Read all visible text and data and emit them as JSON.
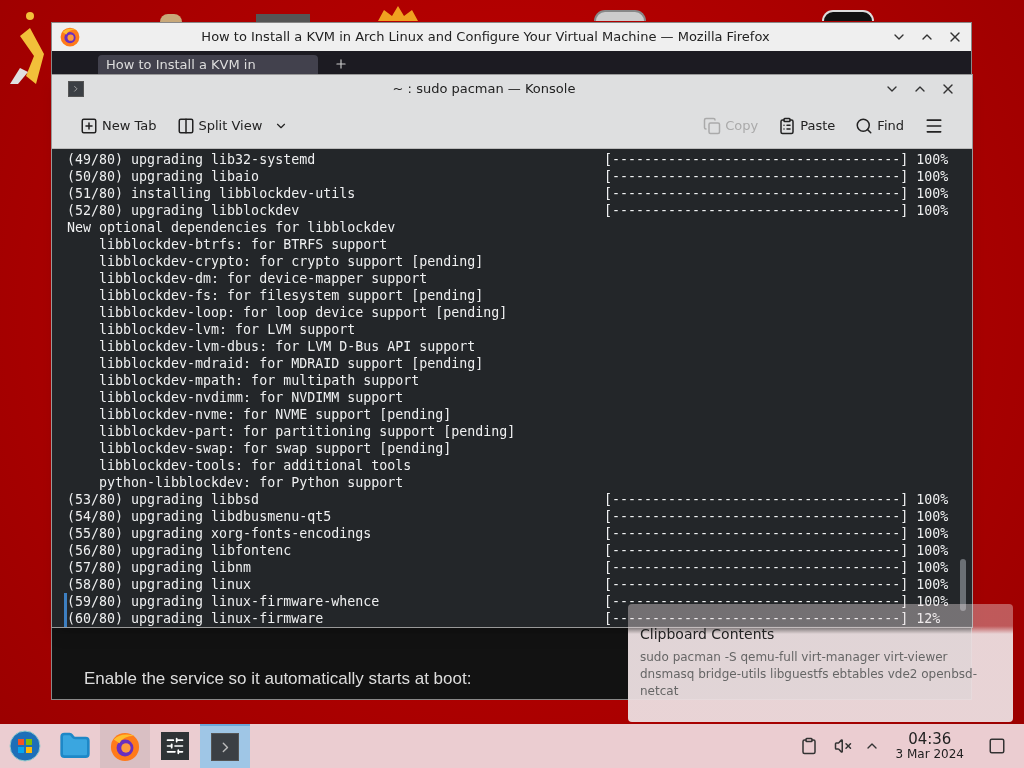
{
  "firefox": {
    "title": "How to Install a KVM in Arch Linux and Configure Your Virtual Machine — Mozilla Firefox",
    "tab": {
      "title": "How to Install a KVM in"
    },
    "content": {
      "text": "Enable the service so it automatically starts at boot:"
    }
  },
  "konsole": {
    "title": "~ : sudo pacman — Konsole",
    "toolbar": [
      {
        "kind": "new-tab",
        "label": "New Tab",
        "disabled": false
      },
      {
        "kind": "split",
        "label": "Split View",
        "disabled": false
      },
      {
        "kind": "copy",
        "label": "Copy",
        "disabled": true
      },
      {
        "kind": "paste",
        "label": "Paste",
        "disabled": false
      },
      {
        "kind": "find",
        "label": "Find",
        "disabled": false
      }
    ],
    "lines": [
      {
        "text": "(49/80) upgrading lib32-systemd",
        "bar": "[------------------------------------]",
        "percent": "100%",
        "marked": false
      },
      {
        "text": "(50/80) upgrading libaio",
        "bar": "[------------------------------------]",
        "percent": "100%",
        "marked": false
      },
      {
        "text": "(51/80) installing libblockdev-utils",
        "bar": "[------------------------------------]",
        "percent": "100%",
        "marked": false
      },
      {
        "text": "(52/80) upgrading libblockdev",
        "bar": "[------------------------------------]",
        "percent": "100%",
        "marked": false
      },
      {
        "text": "New optional dependencies for libblockdev",
        "marked": false
      },
      {
        "text": "    libblockdev-btrfs: for BTRFS support",
        "marked": false
      },
      {
        "text": "    libblockdev-crypto: for crypto support [pending]",
        "marked": false
      },
      {
        "text": "    libblockdev-dm: for device-mapper support",
        "marked": false
      },
      {
        "text": "    libblockdev-fs: for filesystem support [pending]",
        "marked": false
      },
      {
        "text": "    libblockdev-loop: for loop device support [pending]",
        "marked": false
      },
      {
        "text": "    libblockdev-lvm: for LVM support",
        "marked": false
      },
      {
        "text": "    libblockdev-lvm-dbus: for LVM D-Bus API support",
        "marked": false
      },
      {
        "text": "    libblockdev-mdraid: for MDRAID support [pending]",
        "marked": false
      },
      {
        "text": "    libblockdev-mpath: for multipath support",
        "marked": false
      },
      {
        "text": "    libblockdev-nvdimm: for NVDIMM support",
        "marked": false
      },
      {
        "text": "    libblockdev-nvme: for NVME support [pending]",
        "marked": false
      },
      {
        "text": "    libblockdev-part: for partitioning support [pending]",
        "marked": false
      },
      {
        "text": "    libblockdev-swap: for swap support [pending]",
        "marked": false
      },
      {
        "text": "    libblockdev-tools: for additional tools",
        "marked": false
      },
      {
        "text": "    python-libblockdev: for Python support",
        "marked": false
      },
      {
        "text": "(53/80) upgrading libbsd",
        "bar": "[------------------------------------]",
        "percent": "100%",
        "marked": false
      },
      {
        "text": "(54/80) upgrading libdbusmenu-qt5",
        "bar": "[------------------------------------]",
        "percent": "100%",
        "marked": false
      },
      {
        "text": "(55/80) upgrading xorg-fonts-encodings",
        "bar": "[------------------------------------]",
        "percent": "100%",
        "marked": false
      },
      {
        "text": "(56/80) upgrading libfontenc",
        "bar": "[------------------------------------]",
        "percent": "100%",
        "marked": false
      },
      {
        "text": "(57/80) upgrading libnm",
        "bar": "[------------------------------------]",
        "percent": "100%",
        "marked": false
      },
      {
        "text": "(58/80) upgrading linux",
        "bar": "[------------------------------------]",
        "percent": "100%",
        "marked": false
      },
      {
        "text": "(59/80) upgrading linux-firmware-whence",
        "bar": "[------------------------------------]",
        "percent": "100%",
        "marked": true
      },
      {
        "text": "(60/80) upgrading linux-firmware",
        "bar": "[------------------------------------]",
        "percent": "12%",
        "marked": true
      }
    ]
  },
  "notification": {
    "title": "Clipboard Contents",
    "body": "sudo pacman -S qemu-full virt-manager virt-viewer dnsmasq bridge-utils libguestfs ebtables vde2 openbsd-netcat"
  },
  "taskbar": {
    "apps": [
      {
        "kind": "start",
        "open": false,
        "selected": false
      },
      {
        "kind": "files",
        "open": false,
        "selected": false
      },
      {
        "kind": "firefox",
        "open": true,
        "selected": false
      },
      {
        "kind": "settings",
        "open": false,
        "selected": false
      },
      {
        "kind": "terminal",
        "open": true,
        "selected": true
      }
    ],
    "clock": {
      "time": "04:36",
      "date": "3 Mar 2024"
    }
  }
}
